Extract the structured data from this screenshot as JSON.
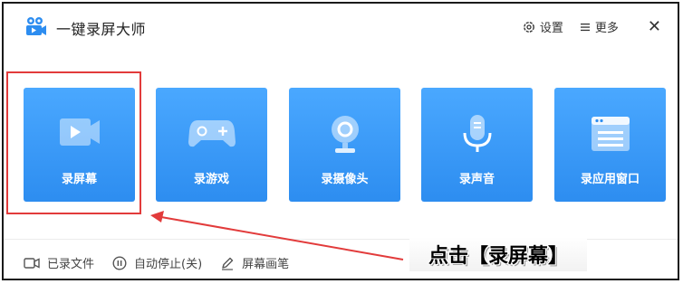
{
  "app": {
    "title": "一键录屏大师"
  },
  "titlebar": {
    "settings_label": "设置",
    "more_label": "更多",
    "close_glyph": "✕"
  },
  "tiles": [
    {
      "label": "录屏幕",
      "icon": "camera-icon"
    },
    {
      "label": "录游戏",
      "icon": "gamepad-icon"
    },
    {
      "label": "录摄像头",
      "icon": "webcam-icon"
    },
    {
      "label": "录声音",
      "icon": "microphone-icon"
    },
    {
      "label": "录应用窗口",
      "icon": "app-window-icon"
    }
  ],
  "footer": {
    "recorded_files": "已录文件",
    "auto_stop": "自动停止(关)",
    "screen_pen": "屏幕画笔"
  },
  "annotation": {
    "callout_text": "点击【录屏幕】"
  },
  "colors": {
    "tile": "#2d8df0",
    "highlight": "#e23b3b",
    "brand": "#2d8df0"
  }
}
